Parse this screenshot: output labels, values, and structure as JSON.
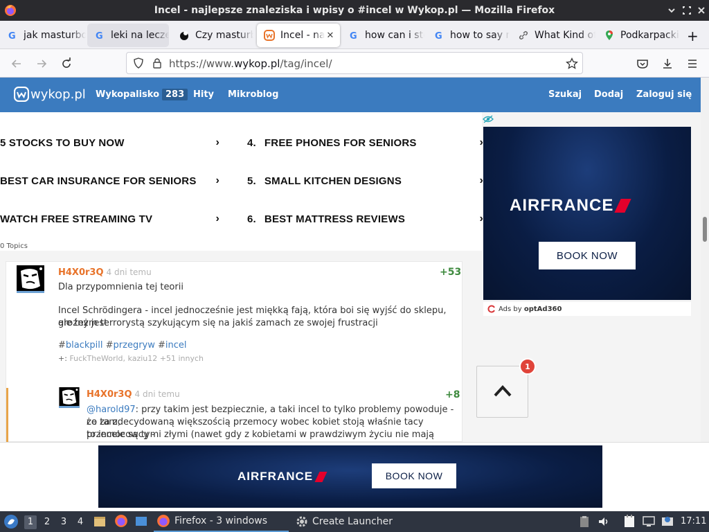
{
  "window": {
    "title": "Incel - najlepsze znaleziska i wpisy o #incel w Wykop.pl — Mozilla Firefox"
  },
  "tabs": [
    {
      "label": "jak masturbować",
      "favicon": "google-icon",
      "state": "normal"
    },
    {
      "label": "leki na leczenie",
      "favicon": "google-icon",
      "state": "hover"
    },
    {
      "label": "Czy masturbacja",
      "favicon": "site-icon",
      "state": "normal"
    },
    {
      "label": "Incel - najlepsze",
      "favicon": "wykop-icon",
      "state": "active"
    },
    {
      "label": "how can i stop",
      "favicon": "google-icon",
      "state": "normal"
    },
    {
      "label": "how to say no",
      "favicon": "google-icon",
      "state": "normal"
    },
    {
      "label": "What Kind of",
      "favicon": "link-icon",
      "state": "normal"
    },
    {
      "label": "Podkarpackie",
      "favicon": "maps-pin-icon",
      "state": "normal"
    }
  ],
  "tab_close": "✕",
  "new_tab": "+",
  "address_bar": {
    "prefix": "https://www.",
    "domain": "wykop.pl",
    "path": "/tag/incel/"
  },
  "wykop": {
    "logo_text": "wykop.pl",
    "nav": [
      {
        "label": "Wykopalisko",
        "badge": "283"
      },
      {
        "label": "Hity"
      },
      {
        "label": "Mikroblog"
      }
    ],
    "actions": [
      "Szukaj",
      "Dodaj",
      "Zaloguj się"
    ]
  },
  "sponsored_topics": {
    "items": [
      {
        "num": "",
        "label": "5 STOCKS TO BUY NOW"
      },
      {
        "num": "4.",
        "label": "FREE PHONES FOR SENIORS"
      },
      {
        "num": "",
        "label": "BEST CAR INSURANCE FOR SENIORS"
      },
      {
        "num": "5.",
        "label": "SMALL KITCHEN DESIGNS"
      },
      {
        "num": "",
        "label": "WATCH FREE STREAMING TV"
      },
      {
        "num": "6.",
        "label": "BEST MATTRESS REVIEWS"
      }
    ],
    "chevron": "›",
    "footer": "0 Topics"
  },
  "posts": [
    {
      "author": "H4X0r3Q",
      "time": "4 dni temu",
      "votes": "+53",
      "lines": [
        "Dla przypomnienia tej teorii",
        "Incel Schrödingera - incel jednocześnie jest miękką fają, która boi się wyjść do sklepu, ale też jest",
        "groźnym terrorystą szykującym się na jakiś zamach ze swojej frustracji"
      ],
      "tags": [
        "blackpill",
        "przegryw",
        "incel"
      ],
      "voters_prefix": "+:",
      "voters": "FuckTheWorld, kaziu12 +51 innych"
    },
    {
      "author": "H4X0r3Q",
      "time": "4 dni temu",
      "votes": "+8",
      "mention": "@harold97",
      "lines": [
        ": przy takim jest bezpiecznie, a taki incel to tylko problemy powoduje - co tam,",
        "że za zdecydowaną większością przemocy wobec kobiet stoją właśnie tacy przemocowcy -",
        "to incele są tymi złymi (nawet gdy z kobietami w prawdziwym życiu nie mają praktycznie"
      ]
    }
  ],
  "ads": {
    "brand": "AIRFRANCE",
    "cta": "BOOK NOW",
    "attribution_prefix": "Ads by",
    "attribution_name": "optAd360"
  },
  "scroll_top": {
    "arrow": "⌃",
    "notification_count": "1"
  },
  "taskbar": {
    "workspaces": [
      "1",
      "2",
      "3",
      "4"
    ],
    "active_workspace": "1",
    "tasks": [
      {
        "label": "Firefox - 3 windows",
        "icon": "firefox-icon"
      },
      {
        "label": "Create Launcher",
        "icon": "gear-icon"
      }
    ],
    "clock": "17:11"
  },
  "colors": {
    "wykop_blue": "#3b7bbf",
    "author_orange": "#e8732a",
    "vote_green": "#3e8a3e",
    "airfrance_navy": "#0a1d44",
    "airfrance_red": "#e4002b"
  }
}
